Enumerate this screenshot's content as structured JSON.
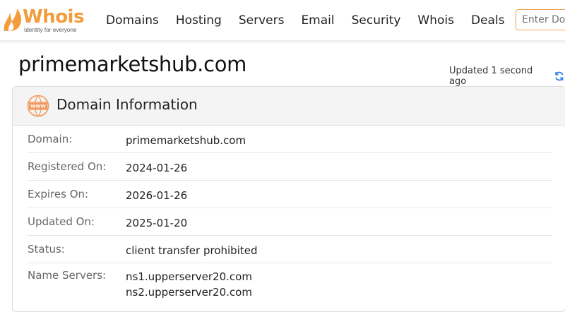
{
  "header": {
    "logo_text": "Whois",
    "logo_tagline": "Identity for everyone",
    "nav": [
      "Domains",
      "Hosting",
      "Servers",
      "Email",
      "Security",
      "Whois",
      "Deals"
    ],
    "search_placeholder": "Enter Domain",
    "accent_color": "#f39c3b"
  },
  "page": {
    "title": "primemarketshub.com",
    "updated_text": "Updated 1 second ago",
    "refresh_icon": "refresh-icon"
  },
  "card": {
    "icon": "www-icon",
    "title": "Domain Information",
    "rows": [
      {
        "label": "Domain:",
        "value": "primemarketshub.com"
      },
      {
        "label": "Registered On:",
        "value": "2024-01-26"
      },
      {
        "label": "Expires On:",
        "value": "2026-01-26"
      },
      {
        "label": "Updated On:",
        "value": "2025-01-20"
      },
      {
        "label": "Status:",
        "value": "client transfer prohibited"
      },
      {
        "label": "Name Servers:",
        "values": [
          "ns1.upperserver20.com",
          "ns2.upperserver20.com"
        ]
      }
    ]
  }
}
